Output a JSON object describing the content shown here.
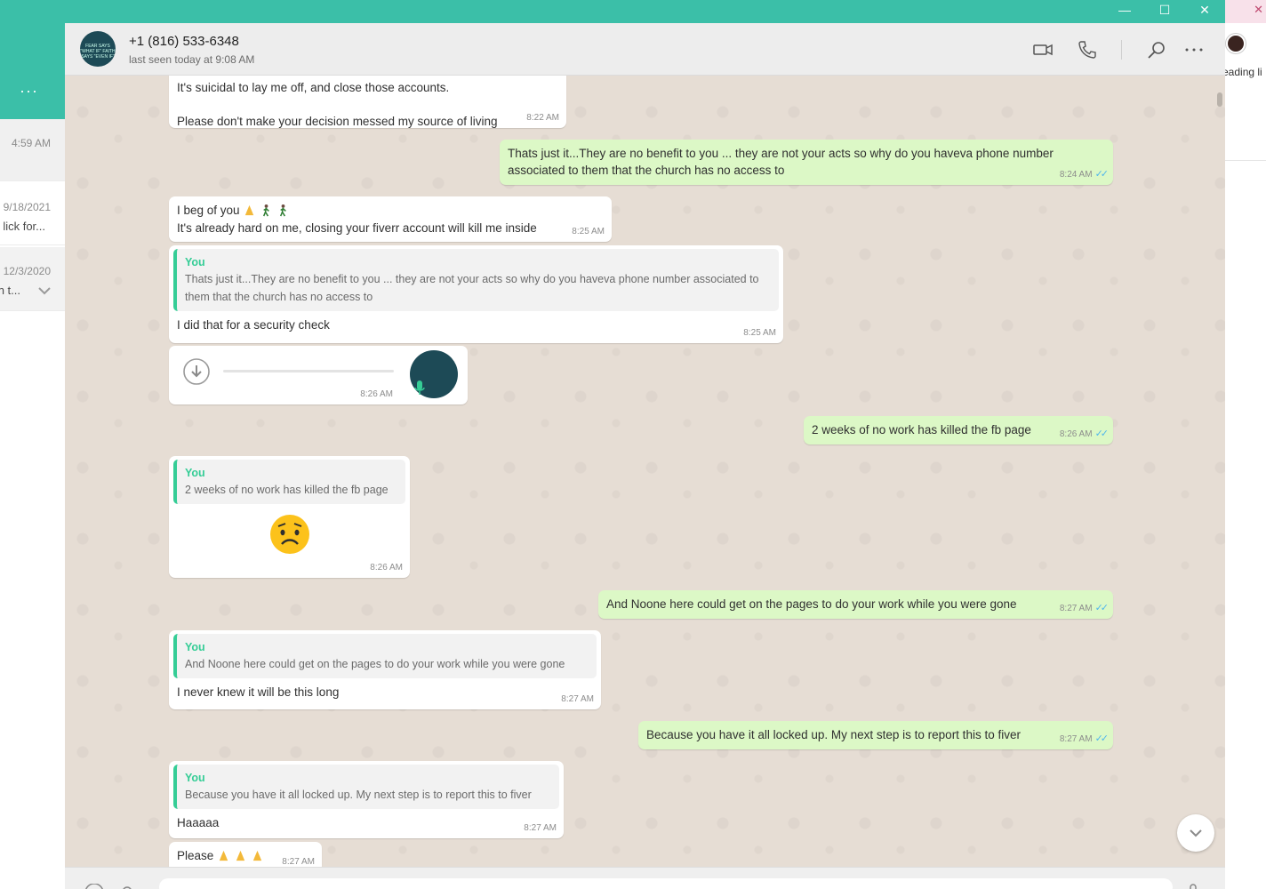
{
  "background_app": {
    "text": "eading li"
  },
  "sidebar": {
    "menu_label": "···",
    "items": [
      {
        "time": "4:59 AM",
        "snippet": ""
      },
      {
        "time": "9/18/2021",
        "snippet": "lick for..."
      },
      {
        "time": "12/3/2020",
        "snippet": "n t..."
      }
    ]
  },
  "header": {
    "contact_name": "+1 (816) 533-6348",
    "status": "last seen today at 9:08 AM",
    "avatar_text": "FEAR SAYS \"WHAT IF\" FAITH SAYS \"EVEN IF\""
  },
  "icons": {
    "video": "video-call-icon",
    "voice": "voice-call-icon",
    "search": "search-icon",
    "menu": "more-options-icon"
  },
  "messages": {
    "m1": {
      "line1": "It's suicidal to lay me off, and close those accounts.",
      "line2": "Please don't make your decision messed my source of living",
      "time": "8:22 AM"
    },
    "m2": {
      "text": "Thats just it...They are no benefit to you ... they are not your acts so why do you haveva phone number associated to them that the church has no access to",
      "time": "8:24 AM"
    },
    "m3": {
      "line1": "I beg of you",
      "line2": "It's already hard on me, closing your fiverr account will kill me inside",
      "time": "8:25 AM"
    },
    "m4": {
      "quote_author": "You",
      "quote_text": "Thats just it...They are no benefit to you ... they are not your acts so why do you haveva phone number associated to them that the church has no access to",
      "text": "I did that for a security check",
      "time": "8:25 AM"
    },
    "m5": {
      "time": "8:26 AM"
    },
    "m6": {
      "text": "2 weeks of no work has killed the fb page",
      "time": "8:26 AM"
    },
    "m7": {
      "quote_author": "You",
      "quote_text": "2 weeks of no work has killed the fb page",
      "time": "8:26 AM"
    },
    "m8": {
      "text": "And Noone here could get on the pages to do your work while you were gone",
      "time": "8:27 AM"
    },
    "m9": {
      "quote_author": "You",
      "quote_text": "And Noone here could get on the pages to do your work while you were gone",
      "text": "I never knew it will be this long",
      "time": "8:27 AM"
    },
    "m10": {
      "text": "Because you have it all locked up.  My next step is to report this to fiver",
      "time": "8:27 AM"
    },
    "m11": {
      "quote_author": "You",
      "quote_text": "Because you have it all locked up.  My next step is to report this to fiver",
      "text": "Haaaaa",
      "time": "8:27 AM"
    },
    "m12": {
      "text": "Please",
      "time": "8:27 AM"
    }
  },
  "colors": {
    "accent": "#3bbfa8",
    "outgoing": "#dcf8c6",
    "incoming": "#ffffff",
    "quote_author": "#35cd96",
    "read_ticks": "#4fb6ec"
  }
}
